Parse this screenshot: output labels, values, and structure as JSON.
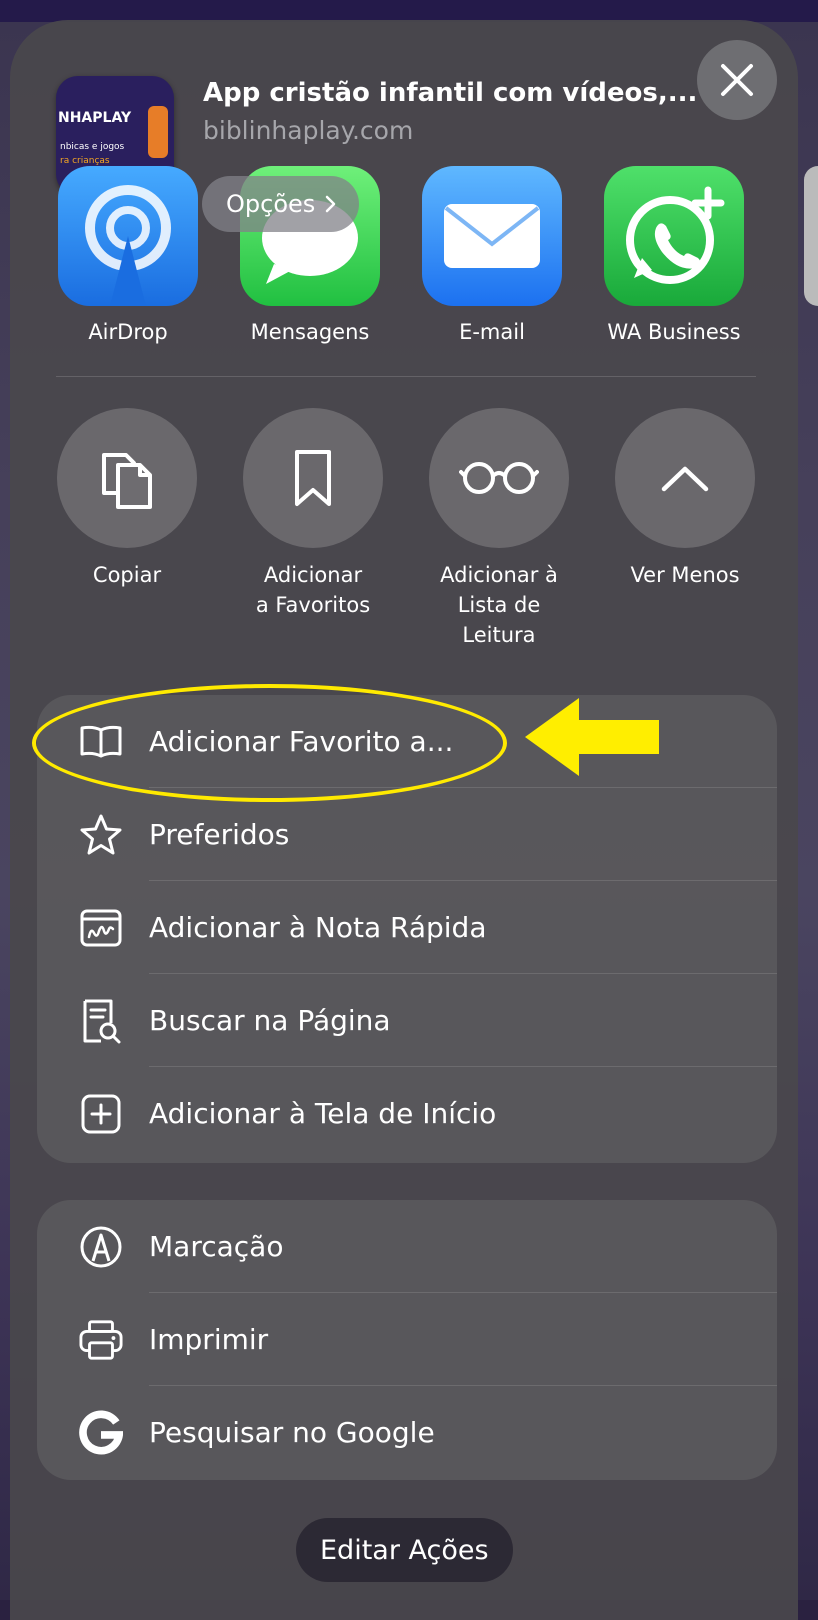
{
  "header": {
    "title": "App cristão infantil com vídeos,...",
    "url": "biblinhaplay.com",
    "options_label": "Opções",
    "thumbnail": {
      "brand_text": "NHAPLAY",
      "line1": "nbicas e jogos",
      "line2": "ra crianças"
    }
  },
  "apps": [
    {
      "label": "AirDrop",
      "icon": "airdrop-icon"
    },
    {
      "label": "Mensagens",
      "icon": "messages-icon"
    },
    {
      "label": "E-mail",
      "icon": "mail-icon"
    },
    {
      "label": "WA Business",
      "icon": "whatsapp-business-icon"
    }
  ],
  "actions": [
    {
      "label": "Copiar",
      "icon": "copy-icon"
    },
    {
      "label": "Adicionar\na Favoritos",
      "icon": "bookmark-icon"
    },
    {
      "label": "Adicionar à\nLista de\nLeitura",
      "icon": "glasses-icon"
    },
    {
      "label": "Ver Menos",
      "icon": "chevron-up-icon"
    }
  ],
  "menu1": [
    {
      "label": "Adicionar Favorito a...",
      "icon": "book-icon"
    },
    {
      "label": "Preferidos",
      "icon": "star-icon"
    },
    {
      "label": "Adicionar à Nota Rápida",
      "icon": "quick-note-icon"
    },
    {
      "label": "Buscar na Página",
      "icon": "find-in-page-icon"
    },
    {
      "label": "Adicionar à Tela de Início",
      "icon": "add-square-icon"
    }
  ],
  "menu2": [
    {
      "label": "Marcação",
      "icon": "markup-icon"
    },
    {
      "label": "Imprimir",
      "icon": "printer-icon"
    },
    {
      "label": "Pesquisar no Google",
      "icon": "google-icon"
    }
  ],
  "footer": {
    "edit_label": "Editar Ações"
  },
  "colors": {
    "highlight": "#ffea00",
    "sheet": "#4a484c",
    "panel": "#5a585c"
  }
}
